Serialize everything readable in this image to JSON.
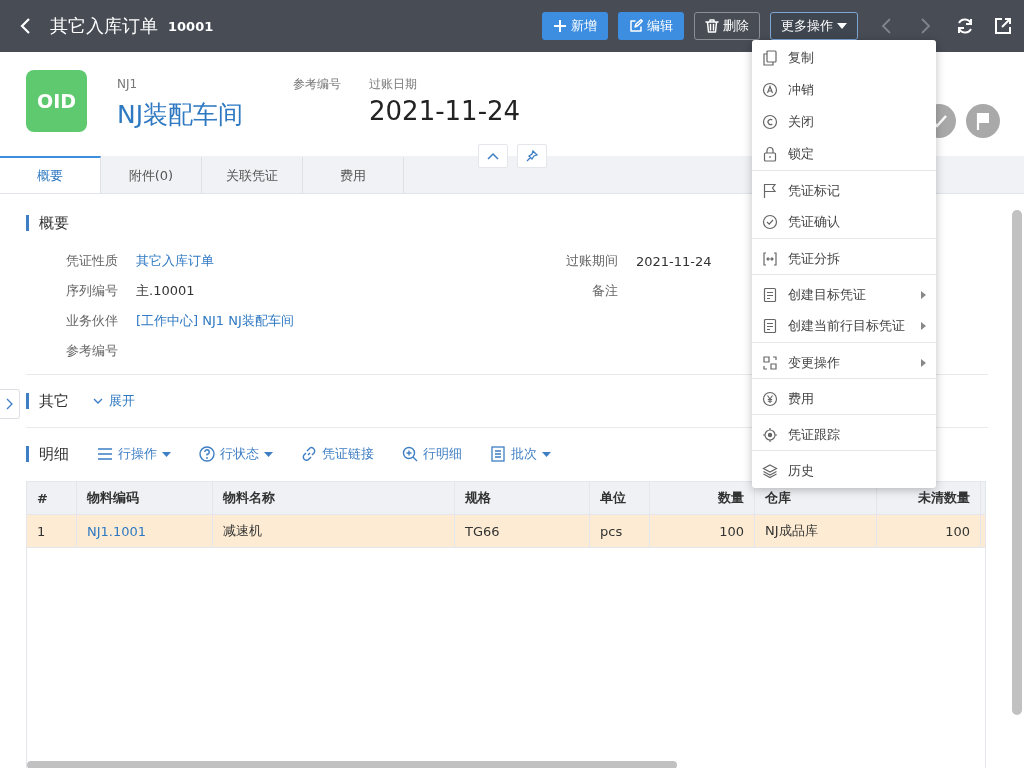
{
  "top_bar": {
    "title": "其它入库订单",
    "number": "10001",
    "buttons": [
      {
        "label": "新增",
        "kind": "primary"
      },
      {
        "label": "编辑",
        "kind": "primary"
      },
      {
        "label": "删除",
        "kind": "outline"
      },
      {
        "label": "更多操作",
        "kind": "menu",
        "expanded": true
      }
    ]
  },
  "header": {
    "badge": "OID",
    "code": "NJ1",
    "name": "NJ装配车间",
    "fields": [
      {
        "label": "参考编号"
      },
      {
        "label": "过账日期",
        "value": "2021-11-24"
      }
    ]
  },
  "tabs": [
    {
      "label": "概要",
      "selected": true
    },
    {
      "label": "附件(0)",
      "selected": false
    },
    {
      "label": "关联凭证",
      "selected": false
    },
    {
      "label": "费用",
      "selected": false
    }
  ],
  "summary": {
    "title": "概要",
    "left_fields": [
      {
        "label": "凭证性质",
        "value": "其它入库订单",
        "link": true
      },
      {
        "label": "序列编号",
        "value": "主.10001",
        "link": false
      },
      {
        "label": "业务伙伴",
        "value": "[工作中心] NJ1 NJ装配车间",
        "link": true
      },
      {
        "label": "参考编号"
      }
    ],
    "right_fields": [
      {
        "label": "过账期间",
        "value": "2021-11-24",
        "link": false
      },
      {
        "label": "备注"
      }
    ]
  },
  "other": {
    "title": "其它",
    "toggle": "展开",
    "expanded": false
  },
  "detail": {
    "title": "明细",
    "toolbar": [
      {
        "label": "行操作",
        "has_menu": true
      },
      {
        "label": "行状态",
        "has_menu": true
      },
      {
        "label": "凭证链接",
        "has_menu": false
      },
      {
        "label": "行明细",
        "has_menu": false
      },
      {
        "label": "批次",
        "has_menu": true
      }
    ],
    "table": {
      "columns": [
        {
          "label": "#"
        },
        {
          "label": "物料编码"
        },
        {
          "label": "物料名称"
        },
        {
          "label": "规格"
        },
        {
          "label": "单位"
        },
        {
          "label": "数量"
        },
        {
          "label": "仓库"
        },
        {
          "label": "未清数量"
        }
      ],
      "rows": [
        {
          "selected": true,
          "cells": [
            "1",
            "NJ1.1001",
            "减速机",
            "TG66",
            "pcs",
            "100",
            "NJ成品库",
            "100"
          ]
        }
      ]
    }
  },
  "more_menu": {
    "items": [
      {
        "label": "复制",
        "submenu": false,
        "separator_before": false
      },
      {
        "label": "冲销",
        "submenu": false,
        "separator_before": false
      },
      {
        "label": "关闭",
        "submenu": false,
        "separator_before": false
      },
      {
        "label": "锁定",
        "submenu": false,
        "separator_before": false
      },
      {
        "label": "凭证标记",
        "submenu": false,
        "separator_before": true
      },
      {
        "label": "凭证确认",
        "submenu": false,
        "separator_before": false
      },
      {
        "label": "凭证分拆",
        "submenu": false,
        "separator_before": true
      },
      {
        "label": "创建目标凭证",
        "submenu": true,
        "separator_before": true
      },
      {
        "label": "创建当前行目标凭证",
        "submenu": true,
        "separator_before": false
      },
      {
        "label": "变更操作",
        "submenu": true,
        "separator_before": true
      },
      {
        "label": "费用",
        "submenu": false,
        "separator_before": true
      },
      {
        "label": "凭证跟踪",
        "submenu": false,
        "separator_before": true
      },
      {
        "label": "历史",
        "submenu": false,
        "separator_before": true
      }
    ]
  }
}
